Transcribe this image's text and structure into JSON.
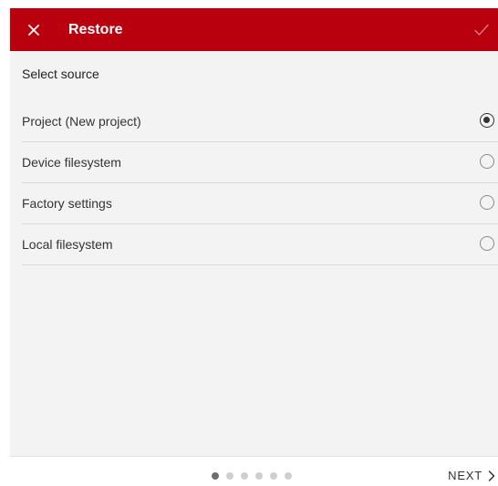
{
  "header": {
    "title": "Restore",
    "close_icon": "close-icon",
    "confirm_icon": "checkmark-icon",
    "bg_color": "#b8000e"
  },
  "main": {
    "section_label": "Select source",
    "options": [
      {
        "label": "Project (New project)",
        "selected": true
      },
      {
        "label": "Device filesystem",
        "selected": false
      },
      {
        "label": "Factory settings",
        "selected": false
      },
      {
        "label": "Local filesystem",
        "selected": false
      }
    ]
  },
  "footer": {
    "step_current": 1,
    "step_total": 6,
    "next_label": "NEXT",
    "next_icon": "chevron-right-icon"
  }
}
